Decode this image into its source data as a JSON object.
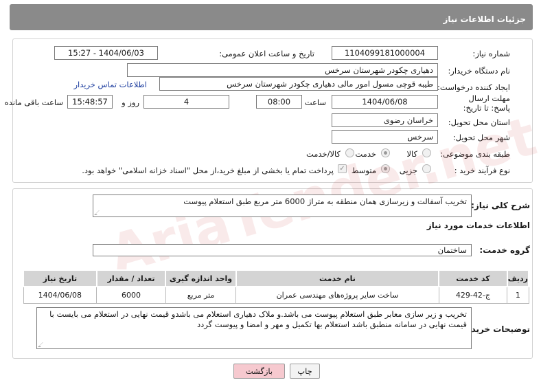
{
  "header": {
    "title": "جزئیات اطلاعات نیاز"
  },
  "form": {
    "need_number_label": "شماره نیاز:",
    "need_number": "1104099181000004",
    "announce_label": "تاریخ و ساعت اعلان عمومی:",
    "announce_value": "1404/06/03 - 15:27",
    "buyer_org_label": "نام دستگاه خریدار:",
    "buyer_org": "دهیاری چکودر شهرستان سرخس",
    "creator_label": "ایجاد کننده درخواست:",
    "creator": "طیبه قوچی مسول امور مالی دهیاری چکودر شهرستان سرخس",
    "contact_link": "اطلاعات تماس خریدار",
    "deadline_label": "مهلت ارسال پاسخ: تا تاریخ:",
    "deadline_date": "1404/06/08",
    "time_label": "ساعت",
    "deadline_time": "08:00",
    "days_value": "4",
    "days_label": "روز و",
    "remaining_time": "15:48:57",
    "remaining_label": "ساعت باقی مانده",
    "province_label": "استان محل تحویل:",
    "province": "خراسان رضوی",
    "city_label": "شهر محل تحویل:",
    "city": "سرخس",
    "category_label": "طبقه بندی موضوعی:",
    "category_options": [
      "کالا",
      "خدمت",
      "کالا/خدمت"
    ],
    "category_selected": "خدمت",
    "process_label": "نوع فرآیند خرید :",
    "process_options": [
      "جزیی",
      "متوسط"
    ],
    "process_selected": "متوسط",
    "payment_note": "پرداخت تمام یا بخشی از مبلغ خرید،از محل \"اسناد خزانه اسلامی\" خواهد بود."
  },
  "summary": {
    "label": "شرح کلی نیاز:",
    "text": "تخریب آسفالت و زیرسازی همان منطقه به متراژ 6000 متر مربع طبق استعلام پیوست"
  },
  "services": {
    "title": "اطلاعات خدمات مورد نیاز",
    "group_label": "گروه خدمت:",
    "group_value": "ساختمان",
    "columns": [
      "ردیف",
      "کد خدمت",
      "نام خدمت",
      "واحد اندازه گیری",
      "تعداد / مقدار",
      "تاریخ نیاز"
    ],
    "rows": [
      [
        "1",
        "ج-42-429",
        "ساخت سایر پروژه‌های مهندسی عمران",
        "متر مربع",
        "6000",
        "1404/06/08"
      ]
    ]
  },
  "buyer_notes": {
    "label": "توضیحات خریدار:",
    "text": "تخریب و زیر سازی معابر طبق استعلام  پیوست می باشد.و ملاک  دهیاری استعلام  می باشدو قیمت نهایی در استعلام می بایست با قیمت  نهایی در سامانه  منطبق باشد استعلام  بها  تکمیل  و مهر و امضا و پیوست  گردد"
  },
  "buttons": {
    "print": "چاپ",
    "back": "بازگشت"
  },
  "watermark": "AriaTender.net",
  "colors": {
    "header_bg": "#8a8a8a",
    "back_button_bg": "#f6c9cf",
    "link": "#2040a0"
  }
}
